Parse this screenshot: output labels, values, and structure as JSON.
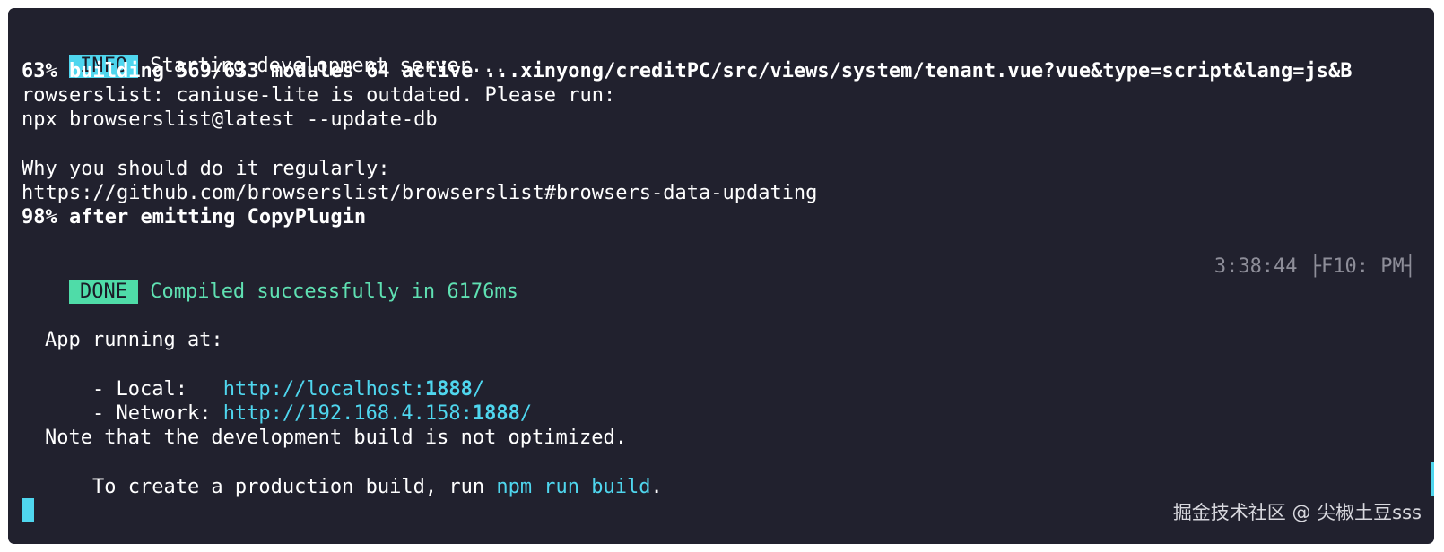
{
  "terminal": {
    "info_badge": "INFO",
    "info_text": " Starting development server...",
    "progress_63": "63% building 569/633 modules 64 active ...xinyong/creditPC/src/views/system/tenant.vue?vue&type=script&lang=js&B",
    "browserslist_line1": "rowserslist: caniuse-lite is outdated. Please run:",
    "browserslist_line2": "npx browserslist@latest --update-db",
    "why_line": "Why you should do it regularly:",
    "url_line": "https://github.com/browserslist/browserslist#browsers-data-updating",
    "progress_98": "98% after emitting CopyPlugin",
    "done_badge": "DONE",
    "done_text": "Compiled successfully in 6176ms",
    "timestamp": "3:38:44 ├F10: PM┤",
    "app_running": "App running at:",
    "local_label": "- Local:   ",
    "local_url_prefix": "http://localhost:",
    "local_port": "1888",
    "local_url_suffix": "/",
    "network_label": "- Network: ",
    "network_url_prefix": "http://192.168.4.158:",
    "network_port": "1888",
    "network_url_suffix": "/",
    "note_line": "Note that the development build is not optimized.",
    "prod_line_prefix": "To create a production build, run ",
    "prod_command": "npm run build",
    "prod_line_suffix": "."
  },
  "watermark": "掘金技术社区 @ 尖椒土豆sss",
  "colors": {
    "background": "#21212e",
    "info_badge": "#4fd6ee",
    "done_badge": "#4fdca8",
    "success_text": "#5fe0b2",
    "link": "#4fd6ee",
    "timestamp": "#8e8e99"
  }
}
